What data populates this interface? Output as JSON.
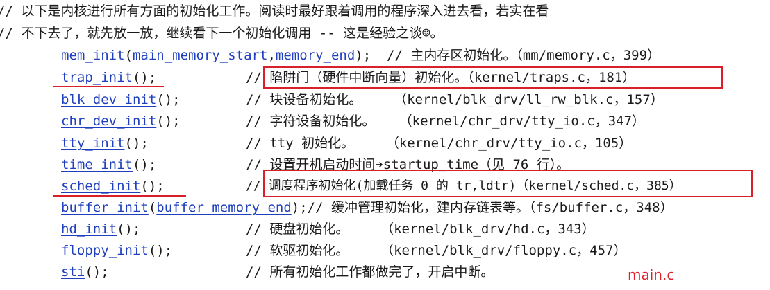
{
  "header_comments": [
    "// 以下是内核进行所有方面的初始化工作。阅读时最好跟着调用的程序深入进去看，若实在看",
    "// 不下去了，就先放一放，继续看下一个初始化调用 -- 这是经验之谈☺。"
  ],
  "lines": [
    {
      "fn": "mem_init",
      "open": "(",
      "args": [
        "main_memory_start",
        "memory_end"
      ],
      "close": ");",
      "comment": "  // 主内存区初始化。（mm/memory.c，399）"
    },
    {
      "fn": "trap_init",
      "call": "();",
      "comment": "// 陷阱门（硬件中断向量）初始化。（kernel/traps.c，181）"
    },
    {
      "fn": "blk_dev_init",
      "call": "();",
      "comment": "// 块设备初始化。    （kernel/blk_drv/ll_rw_blk.c，157）"
    },
    {
      "fn": "chr_dev_init",
      "call": "();",
      "comment": "// 字符设备初始化。   （kernel/chr_drv/tty_io.c，347）"
    },
    {
      "fn": "tty_init",
      "call": "();",
      "comment": "// tty 初始化。    （kernel/chr_drv/tty_io.c，105）"
    },
    {
      "fn": "time_init",
      "call": "();",
      "comment": "// 设置开机启动时间➔startup_time（见 76 行）。"
    },
    {
      "fn": "sched_init",
      "call": "();",
      "comment": "// 调度程序初始化(加载任务 0 的 tr,ldtr)（kernel/sched.c，385）"
    },
    {
      "fn": "buffer_init",
      "open": "(",
      "args": [
        "buffer_memory_end"
      ],
      "close": ");",
      "comment": "// 缓冲管理初始化，建内存链表等。（fs/buffer.c，348）"
    },
    {
      "fn": "hd_init",
      "call": "();",
      "comment": "// 硬盘初始化。    （kernel/blk_drv/hd.c，343）"
    },
    {
      "fn": "floppy_init",
      "call": "();",
      "comment": "// 软驱初始化。    （kernel/blk_drv/floppy.c，457）"
    },
    {
      "fn": "sti",
      "call": "();",
      "comment": "// 所有初始化工作都做完了，开启中断。"
    }
  ],
  "file_label": "main.c",
  "colors": {
    "function": "#1f3fbf",
    "highlight": "#d9202a",
    "text": "#1a1a1a"
  }
}
